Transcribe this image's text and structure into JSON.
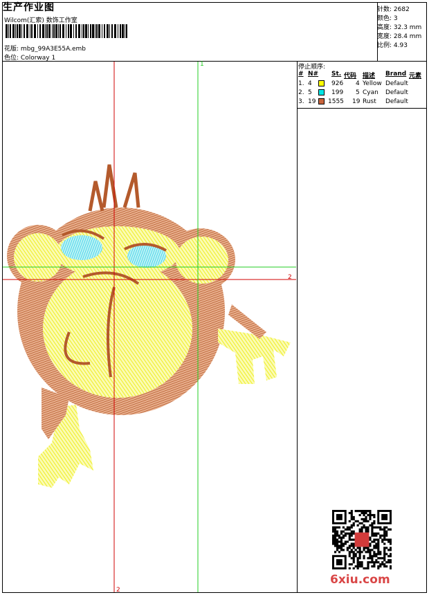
{
  "header": {
    "title": "生产作业图",
    "company": "Wilcom(汇索) 数饰工作室",
    "design_label": "花版:",
    "design_value": "mbg_99A3E55A.emb",
    "colorway_label": "色位:",
    "colorway_value": "Colorway 1"
  },
  "stats": {
    "stitches": "针数: 2682",
    "colors": "颜色: 3",
    "height": "高度: 32.3 mm",
    "width": "宽度: 28.4 mm",
    "scale": "比例: 4.93"
  },
  "guides": {
    "vertical_label": "1",
    "horizontal_label": "2",
    "bottom_label": "2"
  },
  "stop_sequence": {
    "title": "停止顺序:",
    "headers": [
      "#",
      "N#",
      "St.",
      "代码",
      "描述",
      "Brand",
      "元素"
    ],
    "rows": [
      {
        "idx": "1.",
        "n": "4",
        "color": "#ffff00",
        "st": "926",
        "code": "4",
        "desc": "Yellow",
        "brand": "Default"
      },
      {
        "idx": "2.",
        "n": "5",
        "color": "#00e6e6",
        "st": "199",
        "code": "5",
        "desc": "Cyan",
        "brand": "Default"
      },
      {
        "idx": "3.",
        "n": "19",
        "color": "#c8643c",
        "st": "1555",
        "code": "19",
        "desc": "Rust",
        "brand": "Default"
      }
    ]
  },
  "logo_text": "6xiu.com",
  "colors": {
    "yellow": "#f2f25a",
    "cyan": "#4fd6e6",
    "rust": "#b45a2c",
    "guide_red": "#d00000",
    "guide_green": "#22cc22"
  }
}
